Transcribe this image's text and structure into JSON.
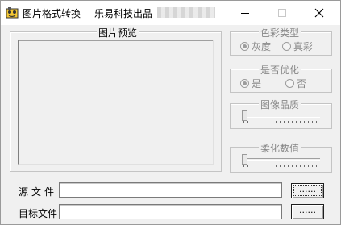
{
  "window": {
    "title": "图片格式转换",
    "subtitle": "乐易科技出品"
  },
  "preview": {
    "legend": "图片预览"
  },
  "color_type": {
    "legend": "色彩类型",
    "options": [
      "灰度",
      "真彩"
    ],
    "selected": "灰度"
  },
  "optimize": {
    "legend": "是否优化",
    "options": [
      "是",
      "否"
    ],
    "selected": "是"
  },
  "quality": {
    "legend": "图像品质",
    "level": 0
  },
  "soften": {
    "legend": "柔化数值",
    "level": 0
  },
  "files": {
    "source_label": "源文件",
    "target_label": "目标文件",
    "source_value": "",
    "target_value": "",
    "browse_label": "......"
  },
  "icons": [
    "app-icon",
    "minimize-icon",
    "maximize-icon",
    "close-icon"
  ]
}
